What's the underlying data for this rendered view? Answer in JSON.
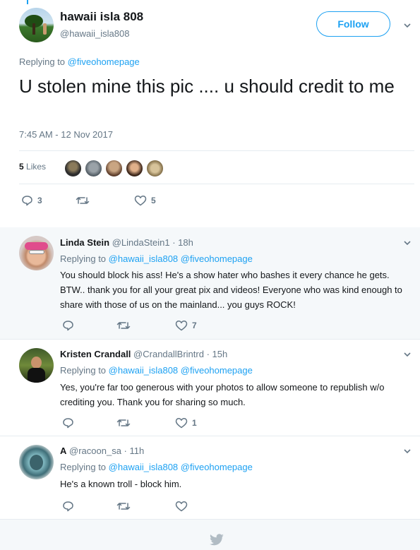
{
  "main_tweet": {
    "display_name": "hawaii isla 808",
    "screen_name": "@hawaii_isla808",
    "follow_label": "Follow",
    "replying_prefix": "Replying to",
    "replying_to": "@fiveohomepage",
    "text": "U stolen mine this pic .... u should credit to me",
    "timestamp": "7:45 AM - 12 Nov 2017",
    "likes_number": "5",
    "likes_label": "Likes",
    "reply_count": "3",
    "retweet_count": "",
    "like_count": "5"
  },
  "replies": [
    {
      "name": "Linda Stein",
      "handle": "@LindaStein1",
      "time": "· 18h",
      "replying_prefix": "Replying to",
      "replying_to": "@hawaii_isla808 @fiveohomepage",
      "text": "You should block his ass! He's a show hater who bashes it every chance he gets. BTW.. thank you for all your great pix and videos! Everyone who was kind enough to share with those of us on the mainland... you guys ROCK!",
      "like_count": "7"
    },
    {
      "name": "Kristen Crandall",
      "handle": "@CrandallBrintrd",
      "time": "· 15h",
      "replying_prefix": "Replying to",
      "replying_to": "@hawaii_isla808 @fiveohomepage",
      "text": "Yes, you're far too generous with your photos to allow someone to republish w/o crediting you. Thank you for sharing so much.",
      "like_count": "1"
    },
    {
      "name": "A",
      "handle": "@racoon_sa",
      "time": "· 11h",
      "replying_prefix": "Replying to",
      "replying_to": "@hawaii_isla808 @fiveohomepage",
      "text": "He's a known troll - block him.",
      "like_count": ""
    }
  ],
  "icons": {
    "reply": "reply-icon",
    "retweet": "retweet-icon",
    "like": "heart-icon",
    "caret": "chevron-down-icon",
    "bird": "twitter-bird-icon"
  },
  "colors": {
    "accent": "#1da1f2",
    "secondary_text": "#657786",
    "highlight_bg": "#f5f8fa",
    "divider": "#e6ecf0"
  }
}
